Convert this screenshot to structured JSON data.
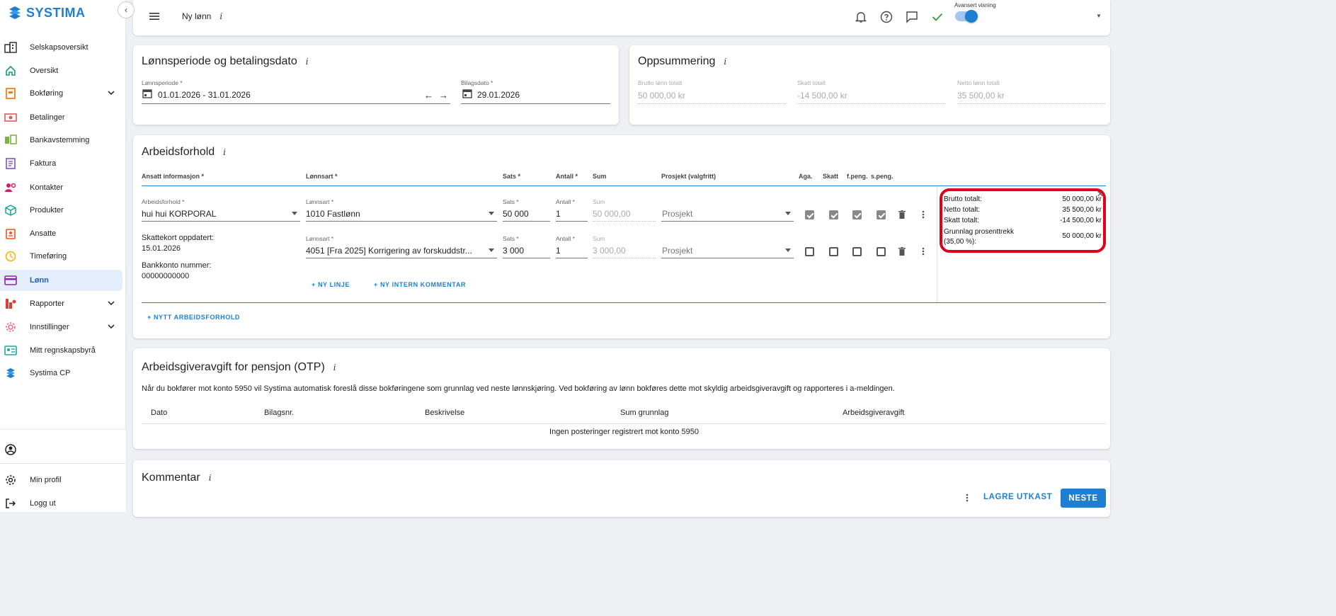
{
  "app": {
    "brand": "SYSTIMA",
    "page_title": "Ny lønn",
    "accent": "#1e7fd2",
    "highlight": "#e0001b"
  },
  "sidebar": {
    "items": [
      {
        "label": "Selskapsoversikt",
        "icon": "buildings-icon"
      },
      {
        "label": "Oversikt",
        "icon": "home-icon"
      },
      {
        "label": "Bokføring",
        "icon": "ledger-icon"
      },
      {
        "label": "Betalinger",
        "icon": "money-icon"
      },
      {
        "label": "Bankavstemming",
        "icon": "bank-icon"
      },
      {
        "label": "Faktura",
        "icon": "invoice-icon"
      },
      {
        "label": "Kontakter",
        "icon": "contacts-icon"
      },
      {
        "label": "Produkter",
        "icon": "cube-icon"
      },
      {
        "label": "Ansatte",
        "icon": "badge-icon"
      },
      {
        "label": "Timeføring",
        "icon": "clock-icon"
      },
      {
        "label": "Lønn",
        "icon": "card-icon"
      },
      {
        "label": "Rapporter",
        "icon": "chart-icon"
      },
      {
        "label": "Innstillinger",
        "icon": "gear-icon"
      },
      {
        "label": "Mitt regnskapsbyrå",
        "icon": "id-card-icon"
      },
      {
        "label": "Systima CP",
        "icon": "systima-icon"
      }
    ],
    "profile": "Min profil",
    "logout": "Logg ut"
  },
  "topbar": {
    "advanced_label": "Avansert visning",
    "advanced_on": true
  },
  "period": {
    "title": "Lønnsperiode og betalingsdato",
    "period_label": "Lønnsperiode *",
    "period_value": "01.01.2026 - 31.01.2026",
    "date_label": "Bilagsdato *",
    "date_value": "29.01.2026"
  },
  "summary": {
    "title": "Oppsummering",
    "brutto_label": "Brutto lønn totalt",
    "brutto_value": "50 000,00 kr",
    "skatt_label": "Skatt totalt",
    "skatt_value": "-14 500,00 kr",
    "netto_label": "Netto lønn totalt",
    "netto_value": "35 500,00 kr"
  },
  "arbeid": {
    "title": "Arbeidsforhold",
    "headers": {
      "ansatt": "Ansatt informasjon *",
      "lonnsart": "Lønnsart *",
      "sats": "Sats *",
      "antall": "Antall *",
      "sum": "Sum",
      "prosjekt": "Prosjekt (valgfritt)",
      "aga": "Aga.",
      "skatt": "Skatt",
      "fpeng": "f.peng.",
      "speng": "s.peng."
    },
    "employee": {
      "label": "Arbeidsforhold *",
      "value": "hui hui KORPORAL",
      "skattekort_label": "Skattekort oppdatert:",
      "skattekort_date": "15.01.2026",
      "bank_label": "Bankkonto nummer:",
      "bank_value": "00000000000"
    },
    "lines": [
      {
        "lonnsart_label": "Lønnsart *",
        "lonnsart": "1010 Fastlønn",
        "sats_label": "Sats *",
        "sats": "50 000",
        "antall_label": "Antall *",
        "antall": "1",
        "sum_label": "Sum",
        "sum": "50 000,00",
        "prosjekt": "Prosjekt",
        "aga": true,
        "skatt": true,
        "fpeng": true,
        "speng": true
      },
      {
        "lonnsart_label": "Lønnsart *",
        "lonnsart": "4051 [Fra 2025] Korrigering av forskuddstr...",
        "sats_label": "Sats *",
        "sats": "3 000",
        "antall_label": "Antall *",
        "antall": "1",
        "sum_label": "Sum",
        "sum": "3 000,00",
        "prosjekt": "Prosjekt",
        "aga": false,
        "skatt": false,
        "fpeng": false,
        "speng": false
      }
    ],
    "new_line": "+ NY LINJE",
    "new_comment": "+ NY INTERN KOMMENTAR",
    "new_arbeidsforhold": "+ NYTT ARBEIDSFORHOLD",
    "totals": {
      "brutto_label": "Brutto totalt:",
      "brutto_value": "50 000,00 kr",
      "netto_label": "Netto totalt:",
      "netto_value": "35 500,00 kr",
      "skatt_label": "Skatt totalt:",
      "skatt_value": "-14 500,00 kr",
      "grunnlag_label_1": "Grunnlag prosenttrekk",
      "grunnlag_label_2": "(35,00 %):",
      "grunnlag_value": "50 000,00 kr"
    }
  },
  "otp": {
    "title": "Arbeidsgiveravgift for pensjon (OTP)",
    "description": "Når du bokfører mot konto 5950 vil Systima automatisk foreslå disse bokføringene som grunnlag ved neste lønnskjøring. Ved bokføring av lønn bokføres dette mot skyldig arbeidsgiveravgift og rapporteres i a-meldingen.",
    "columns": [
      "Dato",
      "Bilagsnr.",
      "Beskrivelse",
      "Sum grunnlag",
      "Arbeidsgiveravgift"
    ],
    "empty": "Ingen posteringer registrert mot konto 5950"
  },
  "kommentar": {
    "title": "Kommentar"
  },
  "footer": {
    "save_draft": "LAGRE UTKAST",
    "next": "NESTE"
  }
}
